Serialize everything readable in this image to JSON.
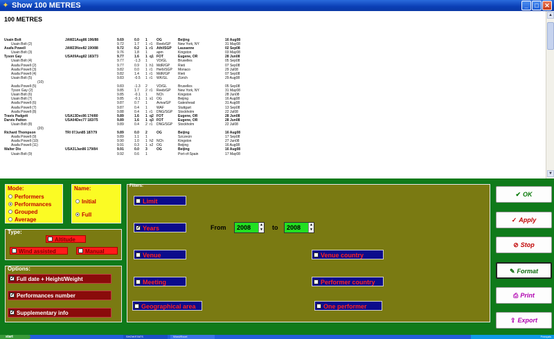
{
  "window": {
    "title": "Show 100 METRES",
    "minimize": "_",
    "maximize": "□",
    "close": "✕"
  },
  "results": {
    "heading": "100 METRES",
    "rows": [
      {
        "bold": true,
        "name": "Usain Bolt",
        "nat": "JAM21Aug86 196/88",
        "mark": "9.69",
        "wind": "0.0",
        "pl": "1",
        "rd": "",
        "comp": "OG",
        "venue": "Beijing",
        "date": "16 Aug08"
      },
      {
        "sub": true,
        "name": "Usain Bolt (2)",
        "nat": "",
        "mark": "9.72",
        "wind": "1.7",
        "pl": "1",
        "rd": "r1",
        "comp": "Reeb/GP",
        "venue": "New York, NY",
        "date": "31 May08"
      },
      {
        "bold": true,
        "name": "Asafa Powell",
        "nat": "JAM23Nov82 190/88",
        "mark": "9.72",
        "wind": "0.2",
        "pl": "1",
        "rd": "r1",
        "comp": "Athl/SGP",
        "venue": "Lausanne",
        "date": "02 Sep08"
      },
      {
        "sub": true,
        "name": "Usain Bolt (3)",
        "nat": "",
        "mark": "9.76",
        "wind": "1.8",
        "pl": "1",
        "rd": "",
        "comp": "apm",
        "venue": "Kingston",
        "date": "03 May08"
      },
      {
        "bold": true,
        "name": "Tyson Gay",
        "nat": "USA09Aug82 183/73",
        "mark": "9.77",
        "wind": "1.6",
        "pl": "1",
        "rd": "q1",
        "comp": "FOT",
        "venue": "Eugene, OR",
        "date": "28 Jun08"
      },
      {
        "sub": true,
        "name": "Usain Bolt (4)",
        "nat": "",
        "mark": "9.77",
        "wind": "-1.3",
        "pl": "1",
        "rd": "",
        "comp": "VD/GL",
        "venue": "Bruxelles",
        "date": "05 Sep08"
      },
      {
        "sub": true,
        "name": "Asafa Powell (2)",
        "nat": "",
        "mark": "9.77",
        "wind": "0.9",
        "pl": "1",
        "rd": "h1",
        "comp": "MdR/GP",
        "venue": "Rieti",
        "date": "07 Sep08"
      },
      {
        "sub": true,
        "name": "Asafa Powell (3)",
        "nat": "",
        "mark": "9.82",
        "wind": "0.0",
        "pl": "1",
        "rd": "r1",
        "comp": "Herb/SGP",
        "venue": "Monaco",
        "date": "29 Jul08"
      },
      {
        "sub": true,
        "name": "Asafa Powell (4)",
        "nat": "",
        "mark": "9.82",
        "wind": "1.4",
        "pl": "1",
        "rd": "r1",
        "comp": "MdR/GP",
        "venue": "Rieti",
        "date": "07 Sep08"
      },
      {
        "sub": true,
        "name": "Usain Bolt (5)",
        "nat": "",
        "mark": "9.83",
        "wind": "-0.5",
        "pl": "1",
        "rd": "r1",
        "comp": "WK/GL",
        "venue": "Zürich",
        "date": "29 Aug08"
      },
      {
        "count": true,
        "name": "(10)"
      },
      {
        "sub": true,
        "name": "Asafa Powell (5)",
        "nat": "",
        "mark": "9.83",
        "wind": "-1.3",
        "pl": "2",
        "rd": "",
        "comp": "VD/GL",
        "venue": "Bruxelles",
        "date": "05 Sep08"
      },
      {
        "sub": true,
        "name": "Tyson Gay (2)",
        "nat": "",
        "mark": "9.85",
        "wind": "1.7",
        "pl": "2",
        "rd": "r1",
        "comp": "Reeb/GP",
        "venue": "New York, NY",
        "date": "31 May08"
      },
      {
        "sub": true,
        "name": "Usain Bolt (6)",
        "nat": "",
        "mark": "9.85",
        "wind": "-0.1",
        "pl": "1",
        "rd": "",
        "comp": "NCh",
        "venue": "Kingston",
        "date": "28 Jun08"
      },
      {
        "sub": true,
        "name": "Usain Bolt (7)",
        "nat": "",
        "mark": "9.85",
        "wind": "-0.1",
        "pl": "1",
        "rd": "s1",
        "comp": "OG",
        "venue": "Beijing",
        "date": "16 Aug08"
      },
      {
        "sub": true,
        "name": "Asafa Powell (6)",
        "nat": "",
        "mark": "9.87",
        "wind": "0.7",
        "pl": "1",
        "rd": "",
        "comp": "Aviva/GP",
        "venue": "Gateshead",
        "date": "31 Aug08"
      },
      {
        "sub": true,
        "name": "Asafa Powell (7)",
        "nat": "",
        "mark": "9.87",
        "wind": "0.4",
        "pl": "1",
        "rd": "",
        "comp": "WAF",
        "venue": "Stuttgart",
        "date": "13 Sep08"
      },
      {
        "sub": true,
        "name": "Asafa Powell (8)",
        "nat": "",
        "mark": "9.88",
        "wind": "0.4",
        "pl": "1",
        "rd": "r1",
        "comp": "DNG/SGP",
        "venue": "Stockholm",
        "date": "22 Jul08"
      },
      {
        "bold": true,
        "name": "Travis Padgett",
        "nat": "USA13Dec86 174/80",
        "mark": "9.89",
        "wind": "1.6",
        "pl": "1",
        "rd": "q2",
        "comp": "FOT",
        "venue": "Eugene, OR",
        "date": "28 Jun08"
      },
      {
        "bold": true,
        "name": "Darvis Patton",
        "nat": "USA04Dec77 183/75",
        "mark": "9.89",
        "wind": "1.6",
        "pl": "1",
        "rd": "q3",
        "comp": "FOT",
        "venue": "Eugene, OR",
        "date": "28 Jun08"
      },
      {
        "sub": true,
        "name": "Usain Bolt (8)",
        "nat": "",
        "mark": "9.89",
        "wind": "0.4",
        "pl": "2",
        "rd": "r1",
        "comp": "DNG/SGP",
        "venue": "Stockholm",
        "date": "22 Jul08"
      },
      {
        "count": true,
        "name": "(20)"
      },
      {
        "bold": true,
        "name": "Richard Thompson",
        "nat": "TRI 07Jun85 187/79",
        "mark": "9.89",
        "wind": "0.0",
        "pl": "2",
        "rd": "",
        "comp": "OG",
        "venue": "Beijing",
        "date": "16 Aug08"
      },
      {
        "sub": true,
        "name": "Asafa Powell (9)",
        "nat": "",
        "mark": "9.89",
        "wind": "1.1",
        "pl": "1",
        "rd": "",
        "comp": "",
        "venue": "Szczecin",
        "date": "17 Sep08"
      },
      {
        "sub": true,
        "name": "Asafa Powell (10)",
        "nat": "",
        "mark": "9.90",
        "wind": "1.0",
        "pl": "1",
        "rd": "h2",
        "comp": "NCh",
        "venue": "Kingston",
        "date": "27 Jun08"
      },
      {
        "sub": true,
        "name": "Asafa Powell (11)",
        "nat": "",
        "mark": "9.91",
        "wind": "0.3",
        "pl": "1",
        "rd": "s2",
        "comp": "OG",
        "venue": "Beijing",
        "date": "16 Aug08"
      },
      {
        "bold": true,
        "name": "Walter Dix",
        "nat": "USA31Jan86 179/84",
        "mark": "9.91",
        "wind": "0.0",
        "pl": "3",
        "rd": "",
        "comp": "OG",
        "venue": "Beijing",
        "date": "16 Aug08"
      },
      {
        "sub": true,
        "name": "Usain Bolt (9)",
        "nat": "",
        "mark": "9.92",
        "wind": "0.6",
        "pl": "1",
        "rd": "",
        "comp": "",
        "venue": "Port-of-Spain",
        "date": "17 May08"
      }
    ]
  },
  "mode": {
    "legend": "Mode:",
    "options": [
      "Performers",
      "Performances",
      "Grouped",
      "Average"
    ],
    "selected": "Performances"
  },
  "name": {
    "legend": "Name:",
    "options": [
      "Initial",
      "Full"
    ],
    "selected": "Full"
  },
  "type": {
    "legend": "Type:",
    "altitude": "Altitude",
    "wind": "Wind assisted",
    "manual": "Manual"
  },
  "options": {
    "legend": "Options:",
    "full_date": "Full date + Height/Weight",
    "perf_number": "Performances number",
    "supp_info": "Supplementary info"
  },
  "filters": {
    "legend": "Filters:",
    "limit": "Limit",
    "years": "Years",
    "from_label": "From",
    "from_value": "2008",
    "to_label": "to",
    "to_value": "2008",
    "venue": "Venue",
    "venue_country": "Venue country",
    "meeting": "Meeting",
    "performer_country": "Performer country",
    "geo_area": "Geographical area",
    "one_performer": "One performer"
  },
  "actions": {
    "ok": "OK",
    "apply": "Apply",
    "stop": "Stop",
    "format": "Format",
    "print": "Print",
    "export": "Export"
  },
  "taskbar": {
    "start": "start",
    "task1": "SHOWSTATS",
    "task2": "Word/Excel",
    "tray": "Français"
  },
  "colors": {
    "panel_green": "#0f7a1a",
    "olive": "#7a7a12",
    "yellow": "#fbfb24",
    "navy": "#0b0b8c",
    "red": "#ff1a1a",
    "darkred": "#8a0b0b"
  }
}
